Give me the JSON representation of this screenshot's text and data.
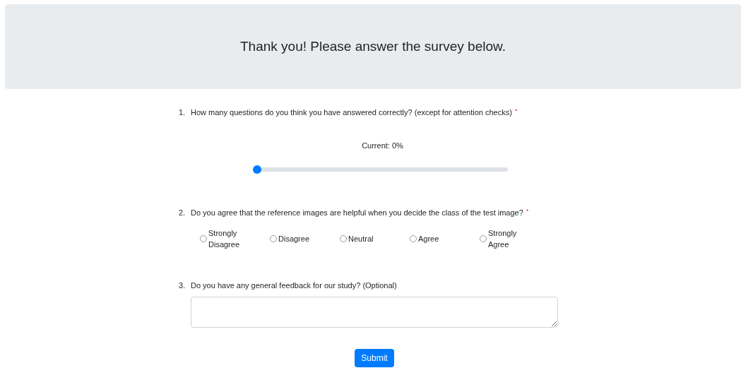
{
  "header": {
    "title": "Thank you! Please answer the survey below."
  },
  "questions": [
    {
      "kind": "slider",
      "number": "1.",
      "text": "How many questions do you think you have answered correctly? (except for attention checks)",
      "required_mark": "*",
      "reading": "Current: 0%",
      "level": 0
    },
    {
      "kind": "radio",
      "number": "2.",
      "text": "Do you agree that the reference images are helpful when you decide the class of the test image?",
      "required_mark": "*",
      "options": [
        {
          "label": "Strongly Disagree",
          "selected": false
        },
        {
          "label": "Disagree",
          "selected": false
        },
        {
          "label": "Neutral",
          "selected": false
        },
        {
          "label": "Agree",
          "selected": false
        },
        {
          "label": "Strongly Agree",
          "selected": false
        }
      ]
    },
    {
      "kind": "text",
      "number": "3.",
      "text": "Do you have any general feedback for our study? (Optional)"
    }
  ],
  "submit": "Submit"
}
